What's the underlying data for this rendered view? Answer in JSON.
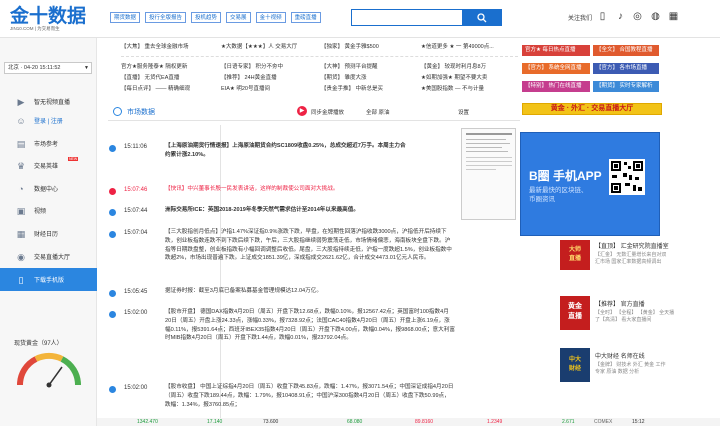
{
  "header": {
    "logo_main": "金十数据",
    "logo_sub": "JIN10.COM | 为交易而生",
    "top_links": [
      "期货数据",
      "投行全版报告",
      "投机趋势",
      "交易展",
      "金十视频",
      "重磅直播"
    ],
    "search_placeholder": "",
    "follow_label": "关注我们"
  },
  "sidebar": {
    "datetime": "北京 · 04-20 15:11:52",
    "items": [
      {
        "label": "智无视频直播",
        "icon": "play-icon"
      },
      {
        "label": "登录 | 注册",
        "icon": "user-icon"
      },
      {
        "label": "市场参考",
        "icon": "doc-icon"
      },
      {
        "label": "交易英雄",
        "icon": "trophy-icon",
        "badge": "NEW"
      },
      {
        "label": "数据中心",
        "icon": "chart-icon"
      },
      {
        "label": "视频",
        "icon": "video-icon"
      },
      {
        "label": "财经日历",
        "icon": "calendar-icon"
      },
      {
        "label": "交易直播大厅",
        "icon": "mic-icon"
      },
      {
        "label": "下载手机版",
        "icon": "mobile-icon"
      }
    ],
    "gauge_title": "现货黄金（97人）"
  },
  "topnews": [
    [
      "【大焦】 重去全球金融市场",
      "★大数据【★★★】人 交易大厅",
      "【独家】 黄金手雅$500",
      "★信道更多 ★ 一 第49000点..."
    ],
    [
      "官方★服务隆泰★ 隔权更新",
      "【日语专家】 积分不夯中",
      "【大神】 预测平台提醒",
      "【黄金】 较现时利月息8万"
    ],
    [
      "【直播】 无货代EA直播",
      "【推荐】 24H黄金直播",
      "【期货】 雏度大涨",
      "★如期加强★ 期望不要大卖"
    ],
    [
      "【每日点评】 —— 精确细观",
      "EIA★ 明20号直播间",
      "【贵金手推】 中新总是买",
      "★美国股指数 — 不与计量"
    ]
  ],
  "right": {
    "buttons_row1": [
      "官方★ 每日热点直播",
      "【全文】 合国教程直播"
    ],
    "buttons_row2": [
      "【官方】 系统全网直播",
      "【官方】 各市场直播"
    ],
    "buttons_row3": [
      "【特别】 热门在线直播",
      "【期货】 实时专家解析"
    ],
    "banner_text": "黄金 · 外汇 · 交易直播大厅",
    "app_title": "B圈 手机APP",
    "app_sub1": "最新最快的区块链、",
    "app_sub2": "币圈资讯",
    "ads": [
      {
        "title": "【直顶】 汇金研究院直播室",
        "line1": "【汇金】 无数汇量增长来自对双",
        "line2": "汇市场 国家汇率数据高频调出"
      },
      {
        "title": "【推荐】 官方直播",
        "line1": "【全时】 【全程】 【黄金】 全天播",
        "line2": "了【高清】 看大家直播间"
      },
      {
        "title": "中大财经 名师在线",
        "line1": "【金牌】 财技术 外汇 黄金 工作",
        "line2": "专家 原油 数据 分析"
      }
    ]
  },
  "tabs": {
    "title": "市场数据",
    "control1": "同步金牌播放",
    "control2": "全部 原油",
    "control3": "设置"
  },
  "feed": [
    {
      "time": "15:11:06",
      "text": "【上海原油期货行情速报】上海原油期货合约SC1809收盘0.25%，总成交超近7万手。本周主力合约累计涨2.10%。",
      "bold": true,
      "red": false
    },
    {
      "time": "15:07:46",
      "text": "【快讯】中兴董事长殷一民发表讲话，这样的制裁使公司面对大挑战。",
      "bold": false,
      "red": true
    },
    {
      "time": "15:07:44",
      "text": "洲际交易所ICE：英国2018-2019年冬季天然气需求估计至2014年以来最高值。",
      "bold": true,
      "red": false
    },
    {
      "time": "15:07:04",
      "text": "【三大股指创月低点】沪指1.47%深证指0.9%涨跌下跌，早盘，在短期性回落沪指收跌3000点，沪指低开后持续下跌，创业板指数连跌不到下跌后续下跌，午后，三大股指继续弱势震荡走低，市场情绪偏悲，海南板块全盘下跌。沪指等日期跌盘整，创业板指跌有小幅回调调整后收低。尾盘，三大股指持续走低，沪指一度跌超1.5%，创业板指数中跌超2%，市场出现普遍下跌。上证成交1851.39亿，深成指成交2621.62亿，合计成交4473.01亿元人民币。",
      "bold": false,
      "red": false
    },
    {
      "time": "15:05:45",
      "text": "据证券时报：截至3月底已备案私募基金管理规模达12.04万亿。",
      "bold": false,
      "red": false
    },
    {
      "time": "15:02:00",
      "text": "【股市开盘】 德国DAX指数4月20日（周五）开盘下跌12.68点，跌幅0.10%，报12567.42点；英国富时100指数4月20日（周五）开盘上涨24.33点，涨幅0.33%，报7328.92点；法国CAC40指数4月20日（周五）开盘上涨6.19点，涨幅0.11%，报5391.64点；西班牙IBEX35指数4月20日（周五）开盘下跌4.00点，跌幅0.04%，报9868.00点；意大利富时MIB指数4月20日（周五）开盘下跌1.44点，跌幅0.01%，报23792.04点。",
      "bold": false,
      "red": false
    },
    {
      "time": "15:02:00",
      "text": "【股市收盘】 中国上证综指4月20日（周五）收盘下跌45.83点，跌幅：1.47%，报3071.54点；中国深证成指4月20日（周五）收盘下跌189.44点，跌幅：1.79%，报10408.91点；中国沪深300指数4月20日（周五）收盘下跌50.99点，跌幅：1.34%，报3760.85点；",
      "bold": false,
      "red": false
    }
  ],
  "ticker": [
    "1342.470",
    "17.140",
    "73.600",
    "68.080",
    "89.8160",
    "1.2349",
    "2.671",
    "COMEX",
    "15:12"
  ]
}
